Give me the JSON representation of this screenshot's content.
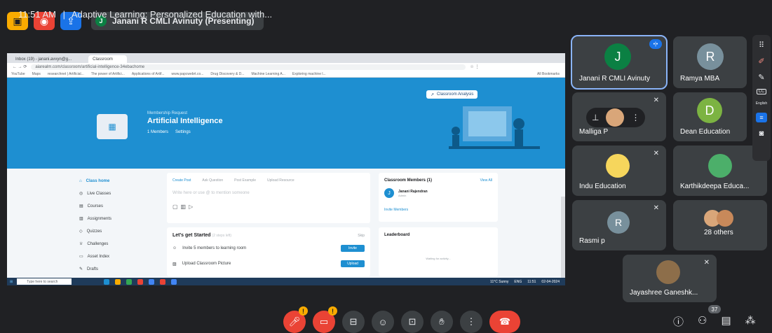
{
  "presenter": {
    "initial": "J",
    "label": "Janani R CMLI Avinuty (Presenting)"
  },
  "browser": {
    "tabs": [
      "Inbox (19) - janani.avvyn@g...",
      "Classroom"
    ],
    "url": "aiarealm.com/classroom/artificial-intelligence-34ebachome",
    "bookmarks": [
      "YouTube",
      "Maps",
      "researchnet | Artificial...",
      "The power of Artifici...",
      "Applications of Artif...",
      "www.papcwebrt.co...",
      "Drug Discovery & D...",
      "Machine Learning A...",
      "Exploring machine l...",
      "All Bookmarks"
    ]
  },
  "classroom": {
    "membership": "Membership Request",
    "title": "Artificial Intelligence",
    "members_count": "1 Members",
    "settings": "Settings",
    "analysis_btn": "Classroom Analysis",
    "nav": [
      "Class home",
      "Live Classes",
      "Courses",
      "Assignments",
      "Quizzes",
      "Challenges",
      "Asset Index",
      "Drafts"
    ],
    "post_tabs": [
      "Create Post",
      "Ask Question",
      "Post Example",
      "Upload Resource"
    ],
    "post_placeholder": "Write here or use @ to mention someone",
    "started_title": "Let's get Started",
    "started_sub": "(2 steps left)",
    "skip": "Skip",
    "steps": [
      {
        "label": "Invite 5 members to learning room",
        "btn": "Invite"
      },
      {
        "label": "Upload Classroom Picture",
        "btn": "Upload"
      }
    ],
    "members_title": "Classroom Members (1)",
    "view_all": "View All",
    "member_name": "Janani Rajendran",
    "member_role": "Admin",
    "invite_members": "Invite Members",
    "leaderboard": "Leaderboard",
    "leader_empty": "Waiting for activity..."
  },
  "taskbar": {
    "search": "Type here to search",
    "weather": "11°C Sunny",
    "lang": "ENG",
    "time": "11:51",
    "date": "02-04-2024"
  },
  "participants": [
    {
      "name": "Janani R CMLI Avinuty",
      "initial": "J",
      "color": "#0b8043"
    },
    {
      "name": "Ramya MBA",
      "initial": "R",
      "color": "#78909c"
    },
    {
      "name": "Malliga P"
    },
    {
      "name": "Dean Education",
      "initial": "D",
      "color": "#7cb342"
    },
    {
      "name": "Indu Education"
    },
    {
      "name": "Karthikdeepa Educa..."
    },
    {
      "name": "Rasmi p",
      "initial": "R",
      "color": "#78909c"
    },
    {
      "name": "28 others"
    },
    {
      "name": "Jayashree Ganeshk..."
    }
  ],
  "rail": {
    "cc": "CC",
    "lang": "English"
  },
  "meeting": {
    "time": "11:51 AM",
    "separator": "|",
    "title": "Adaptive Learning: Personalized Education with..."
  },
  "badges": {
    "mic": "!",
    "cam": "!",
    "people": "37"
  }
}
